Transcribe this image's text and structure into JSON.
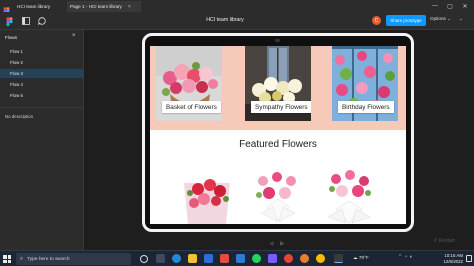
{
  "titlebar": {
    "tabs": [
      {
        "label": "HCI team library"
      },
      {
        "label": "Page 1 - HCI team library"
      }
    ],
    "window_controls": [
      "—",
      "▢",
      "✕"
    ]
  },
  "toolbar": {
    "doc_title": "HCI team library",
    "avatar_initial": "C",
    "share_label": "Share prototype",
    "options_label": "Options ⌄",
    "zoom_label": "⌄"
  },
  "sidebar": {
    "header": "Flows",
    "items": [
      {
        "label": "Flow 1"
      },
      {
        "label": "Flow 2"
      },
      {
        "label": "Flow 3",
        "selected": true
      },
      {
        "label": "Flow 4"
      },
      {
        "label": "Flow 5"
      }
    ],
    "no_description": "No description"
  },
  "prototype": {
    "categories": [
      {
        "label": "Basket of Flowers"
      },
      {
        "label": "Sympathy Flowers"
      },
      {
        "label": "Birthday Flowers"
      }
    ],
    "featured_title": "Featured Flowers",
    "hero_color": "#f6c9b8"
  },
  "canvas": {
    "prev_arrow": "◀",
    "next_arrow": "▶",
    "restart_label": "↺ Restart"
  },
  "taskbar": {
    "search_placeholder": "Type here to search",
    "weather": "79°F",
    "time": "10:16 AM",
    "date": "12/6/2022"
  },
  "colors": {
    "accent": "#0d99ff",
    "avatar": "#e85d2a"
  }
}
